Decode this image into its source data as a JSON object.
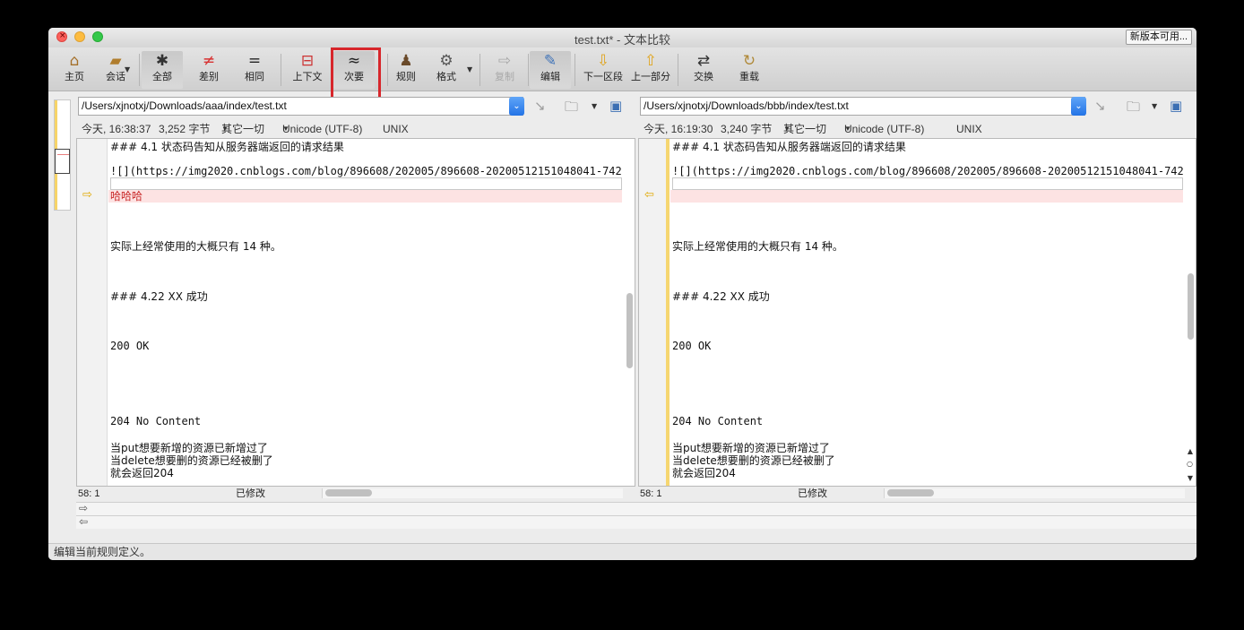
{
  "window": {
    "title": "test.txt* - 文本比较",
    "update_button": "新版本可用..."
  },
  "toolbar": {
    "home": "主页",
    "session": "会话",
    "all": "全部",
    "diffs": "差别",
    "same": "相同",
    "context": "上下文",
    "minor": "次要",
    "rules": "规则",
    "format": "格式",
    "copy": "复制",
    "edit": "编辑",
    "next_section": "下一区段",
    "prev_section": "上一部分",
    "swap": "交换",
    "reload": "重载"
  },
  "icons": {
    "home": "house-icon",
    "session": "briefcase-icon",
    "all": "asterisk-icon",
    "diffs": "not-equal-icon",
    "same": "equal-icon",
    "context": "context-icon",
    "minor": "approx-icon",
    "rules": "referee-icon",
    "format": "gear-doc-icon",
    "copy": "arrow-right-icon",
    "edit": "pencil-icon",
    "next_section": "arrow-down-icon",
    "prev_section": "arrow-up-icon",
    "swap": "swap-icon",
    "reload": "reload-icon"
  },
  "left": {
    "path": "/Users/xjnotxj/Downloads/aaa/index/test.txt",
    "timestamp": "今天, 16:38:37",
    "size": "3,252 字节",
    "filter": "其它一切",
    "encoding": "Unicode (UTF-8)",
    "line_endings": "UNIX",
    "cursor": "58: 1",
    "modified": "已修改",
    "lines": {
      "heading_status": "### 4.1 状态码告知从服务器端返回的请求结果",
      "image_link": "![](https://img2020.cnblogs.com/blog/896608/202005/896608-20200512151048041-742930",
      "diff_text": "哈哈哈",
      "common_count": "实际上经常使用的大概只有 14 种。",
      "heading_success": "### 4.22 XX 成功",
      "ok": "200 OK",
      "no_content": "204 No Content",
      "put_note": "当put想要新增的资源已新增过了",
      "delete_note": "当delete想要删的资源已经被删了",
      "returns": "就会返回204"
    }
  },
  "right": {
    "path": "/Users/xjnotxj/Downloads/bbb/index/test.txt",
    "timestamp": "今天, 16:19:30",
    "size": "3,240 字节",
    "filter": "其它一切",
    "encoding": "Unicode (UTF-8)",
    "line_endings": "UNIX",
    "cursor": "58: 1",
    "modified": "已修改",
    "lines": {
      "heading_status": "### 4.1 状态码告知从服务器端返回的请求结果",
      "image_link": "![](https://img2020.cnblogs.com/blog/896608/202005/896608-20200512151048041-742930",
      "common_count": "实际上经常使用的大概只有 14 种。",
      "heading_success": "### 4.22 XX 成功",
      "ok": "200 OK",
      "no_content": "204 No Content",
      "put_note": "当put想要新增的资源已新增过了",
      "delete_note": "当delete想要删的资源已经被删了",
      "returns": "就会返回204"
    }
  },
  "bottom_status": "编辑当前规则定义。",
  "colors": {
    "highlight_box": "#d7262b",
    "diff_band": "#fde3e3",
    "diff_text": "#c82828",
    "gutter_marker": "#f6d671"
  }
}
